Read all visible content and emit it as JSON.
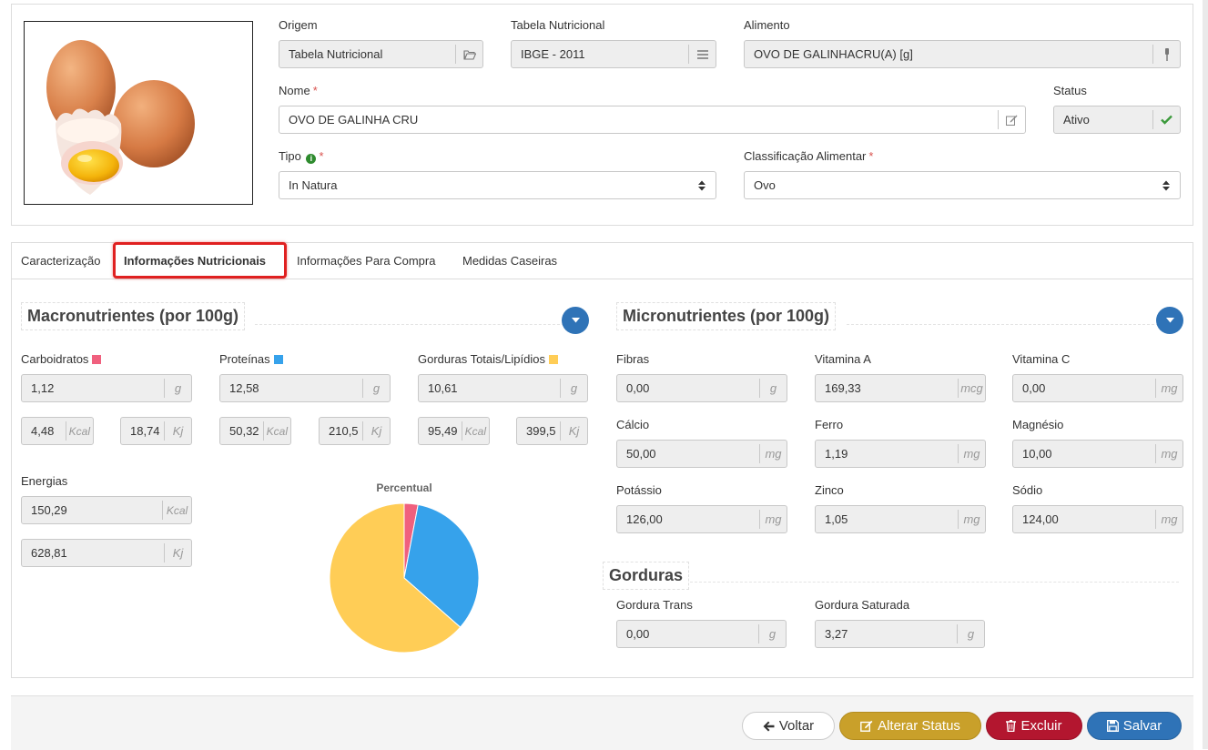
{
  "header": {
    "origem": {
      "label": "Origem",
      "value": "Tabela Nutricional"
    },
    "tabela": {
      "label": "Tabela Nutricional",
      "value": "IBGE - 2011"
    },
    "alimento": {
      "label": "Alimento",
      "value": "OVO DE GALINHACRU(A) [g]"
    },
    "nome": {
      "label": "Nome",
      "value": "OVO DE GALINHA CRU",
      "required": "*"
    },
    "status": {
      "label": "Status",
      "value": "Ativo"
    },
    "tipo": {
      "label": "Tipo",
      "value": "In Natura",
      "required": "*"
    },
    "classificacao": {
      "label": "Classificação Alimentar",
      "value": "Ovo",
      "required": "*"
    }
  },
  "tabs": [
    {
      "label": "Caracterização"
    },
    {
      "label": "Informações Nutricionais"
    },
    {
      "label": "Informações Para Compra"
    },
    {
      "label": "Medidas Caseiras"
    }
  ],
  "macro": {
    "title": "Macronutrientes (por 100g)",
    "carb": {
      "label": "Carboidratos",
      "color": "#f0607e",
      "g": "1,12",
      "unit_g": "g",
      "kcal": "4,48",
      "unit_kcal": "Kcal",
      "kj": "18,74",
      "unit_kj": "Kj"
    },
    "prot": {
      "label": "Proteínas",
      "color": "#36a2eb",
      "g": "12,58",
      "unit_g": "g",
      "kcal": "50,32",
      "unit_kcal": "Kcal",
      "kj": "210,5",
      "unit_kj": "Kj"
    },
    "gord": {
      "label": "Gorduras Totais/Lipídios",
      "color": "#ffcd56",
      "g": "10,61",
      "unit_g": "g",
      "kcal": "95,49",
      "unit_kcal": "Kcal",
      "kj": "399,5",
      "unit_kj": "Kj"
    },
    "energia": {
      "label": "Energias",
      "kcal": "150,29",
      "unit_kcal": "Kcal",
      "kj": "628,81",
      "unit_kj": "Kj"
    }
  },
  "chart_data": {
    "type": "pie",
    "title": "Percentual",
    "categories": [
      "Carboidratos",
      "Proteínas",
      "Gorduras Totais/Lipídios"
    ],
    "values": [
      4.48,
      50.32,
      95.49
    ],
    "colors": [
      "#f0607e",
      "#36a2eb",
      "#ffcd56"
    ]
  },
  "micro": {
    "title": "Micronutrientes (por 100g)",
    "items": [
      {
        "label": "Fibras",
        "value": "0,00",
        "unit": "g"
      },
      {
        "label": "Vitamina A",
        "value": "169,33",
        "unit": "mcg"
      },
      {
        "label": "Vitamina C",
        "value": "0,00",
        "unit": "mg"
      },
      {
        "label": "Cálcio",
        "value": "50,00",
        "unit": "mg"
      },
      {
        "label": "Ferro",
        "value": "1,19",
        "unit": "mg"
      },
      {
        "label": "Magnésio",
        "value": "10,00",
        "unit": "mg"
      },
      {
        "label": "Potássio",
        "value": "126,00",
        "unit": "mg"
      },
      {
        "label": "Zinco",
        "value": "1,05",
        "unit": "mg"
      },
      {
        "label": "Sódio",
        "value": "124,00",
        "unit": "mg"
      }
    ]
  },
  "gorduras": {
    "title": "Gorduras",
    "trans": {
      "label": "Gordura Trans",
      "value": "0,00",
      "unit": "g"
    },
    "saturada": {
      "label": "Gordura Saturada",
      "value": "3,27",
      "unit": "g"
    }
  },
  "actions": {
    "voltar": "Voltar",
    "alterar": "Alterar Status",
    "excluir": "Excluir",
    "salvar": "Salvar"
  }
}
